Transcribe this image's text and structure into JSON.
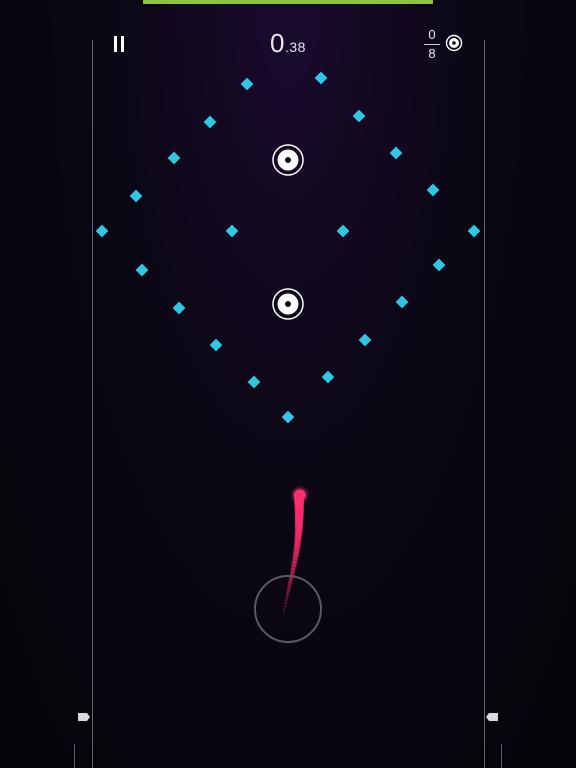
{
  "hud": {
    "timer_seconds": "0",
    "timer_fraction": ".38",
    "targets_hit": "0",
    "targets_total": "8",
    "pause_icon": "pause-icon",
    "target_icon": "target-icon"
  },
  "level_progress_fraction": 1.0,
  "colors": {
    "diamond": "#2ec7e6",
    "ball": "#ff2d6f",
    "progress": "#8cc43c",
    "target_ring": "#ffffff",
    "launcher_ring": "#5a5a66"
  }
}
